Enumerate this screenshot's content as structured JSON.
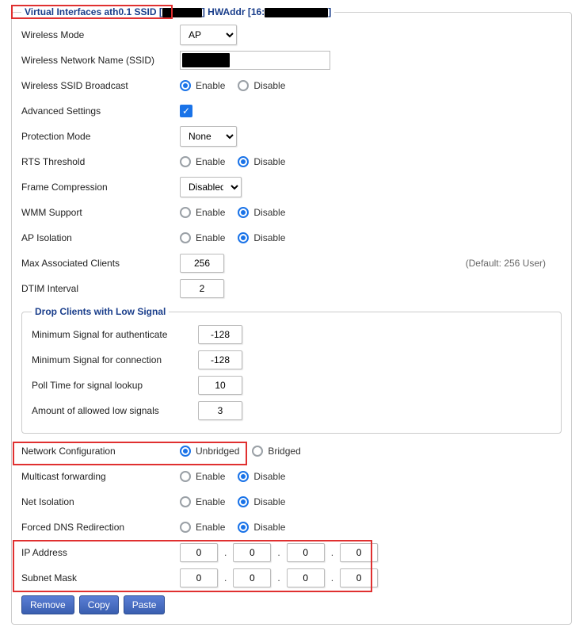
{
  "legend_main": "Virtual Interfaces ath0.1 SSID [",
  "legend_hw": "] HWAddr [16:",
  "legend_end": "]",
  "labels": {
    "wireless_mode": "Wireless Mode",
    "ssid": "Wireless Network Name (SSID)",
    "ssid_broadcast": "Wireless SSID Broadcast",
    "advanced": "Advanced Settings",
    "protection": "Protection Mode",
    "rts": "RTS Threshold",
    "frame_comp": "Frame Compression",
    "wmm": "WMM Support",
    "ap_iso": "AP Isolation",
    "max_clients": "Max Associated Clients",
    "dtim": "DTIM Interval",
    "drop_legend": "Drop Clients with Low Signal",
    "min_sig_auth": "Minimum Signal for authenticate",
    "min_sig_conn": "Minimum Signal for connection",
    "poll_time": "Poll Time for signal lookup",
    "low_signals": "Amount of allowed low signals",
    "net_config": "Network Configuration",
    "mcast_fwd": "Multicast forwarding",
    "net_iso": "Net Isolation",
    "forced_dns": "Forced DNS Redirection",
    "ip_addr": "IP Address",
    "subnet": "Subnet Mask"
  },
  "opts": {
    "enable": "Enable",
    "disable": "Disable",
    "unbridged": "Unbridged",
    "bridged": "Bridged"
  },
  "selects": {
    "wireless_mode": "AP",
    "protection": "None",
    "frame_comp": "Disabled"
  },
  "values": {
    "max_clients": "256",
    "max_clients_hint": "(Default: 256 User)",
    "dtim": "2",
    "min_sig_auth": "-128",
    "min_sig_conn": "-128",
    "poll_time": "10",
    "low_signals": "3",
    "ip": [
      "0",
      "0",
      "0",
      "0"
    ],
    "subnet": [
      "0",
      "0",
      "0",
      "0"
    ]
  },
  "buttons": {
    "remove": "Remove",
    "copy": "Copy",
    "paste": "Paste"
  }
}
